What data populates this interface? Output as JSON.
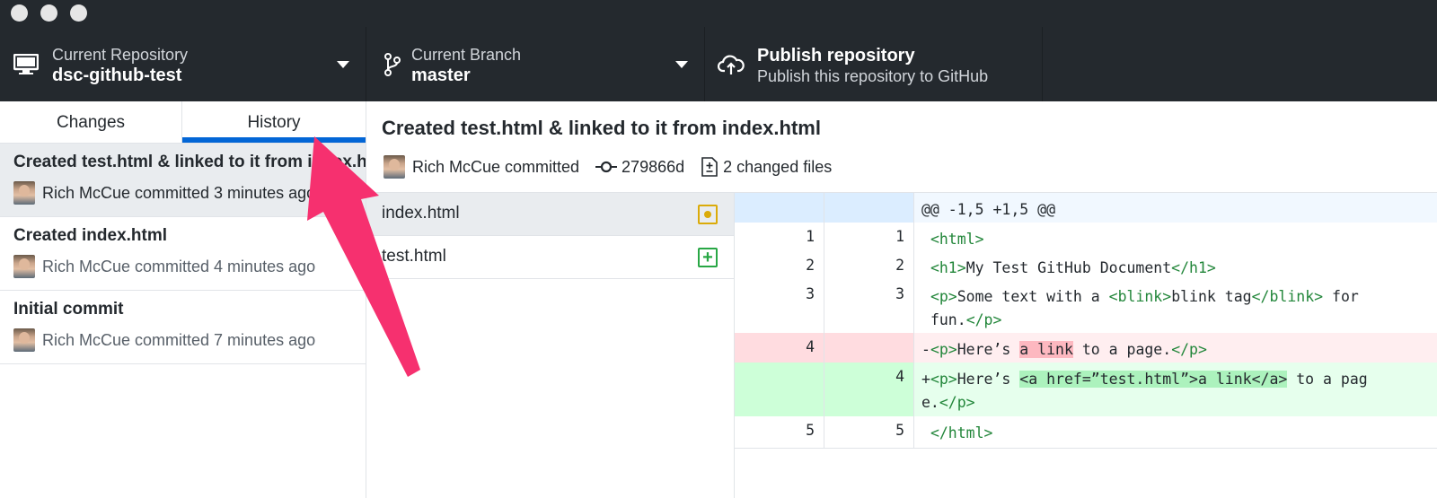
{
  "toolbar": {
    "repository": {
      "label": "Current Repository",
      "value": "dsc-github-test"
    },
    "branch": {
      "label": "Current Branch",
      "value": "master"
    },
    "publish": {
      "title": "Publish repository",
      "subtitle": "Publish this repository to GitHub"
    }
  },
  "tabs": {
    "changes": "Changes",
    "history": "History"
  },
  "commits": [
    {
      "title": "Created test.html & linked to it from index.html",
      "byline": "Rich McCue committed 3 minutes ago"
    },
    {
      "title": "Created index.html",
      "byline": "Rich McCue committed 4 minutes ago"
    },
    {
      "title": "Initial commit",
      "byline": "Rich McCue committed 7 minutes ago"
    }
  ],
  "detail": {
    "title": "Created test.html & linked to it from index.html",
    "author": "Rich McCue committed",
    "sha": "279866d",
    "changed_files": "2 changed files"
  },
  "files": [
    {
      "name": "index.html",
      "status": "modified"
    },
    {
      "name": "test.html",
      "status": "added"
    }
  ],
  "diff": {
    "hunk": "@@ -1,5 +1,5 @@",
    "lines": [
      {
        "old": "1",
        "new": "1"
      },
      {
        "old": "2",
        "new": "2"
      },
      {
        "old": "3",
        "new": "3"
      },
      {
        "old": "4",
        "new": ""
      },
      {
        "old": "",
        "new": "4"
      },
      {
        "old": "5",
        "new": "5"
      }
    ]
  },
  "colors": {
    "toolbar_bg": "#24292e",
    "accent": "#0366d6",
    "annotation_arrow": "#f6306f"
  }
}
